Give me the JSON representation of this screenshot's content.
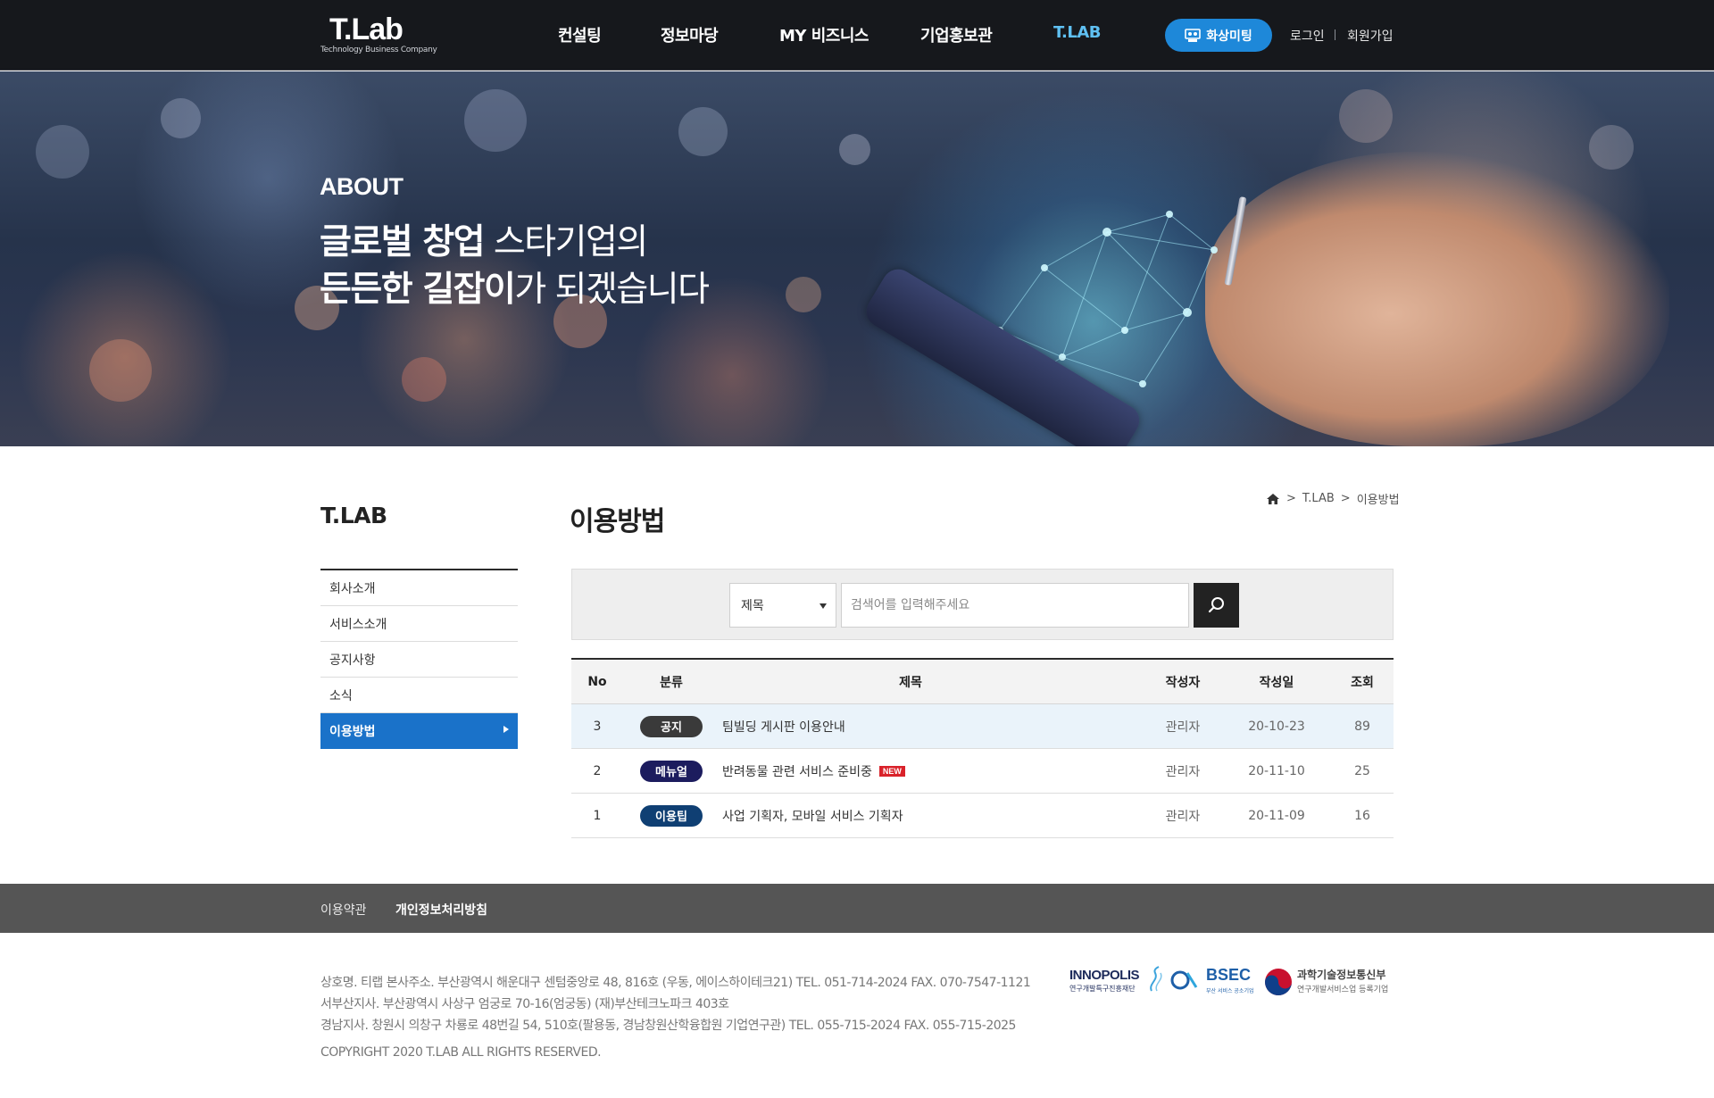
{
  "header": {
    "logo_main": "T.Lab",
    "logo_sub": "Technology Business Company",
    "nav": [
      "컨설팅",
      "정보마당",
      "MY 비즈니스",
      "기업홍보관",
      "T.LAB"
    ],
    "meeting_button": "화상미팅",
    "login": "로그인",
    "signup": "회원가입",
    "accent_color": "#5fc0f2"
  },
  "hero": {
    "label": "ABOUT",
    "line1_bold": "글로벌 창업",
    "line1_rest": " 스타기업의",
    "line2_bold1": "든든한 길잡이",
    "line2_rest": "가 되겠습니다"
  },
  "sidebar": {
    "title": "T.LAB",
    "items": [
      {
        "label": "회사소개"
      },
      {
        "label": "서비스소개"
      },
      {
        "label": "공지사항"
      },
      {
        "label": "소식"
      },
      {
        "label": "이용방법"
      }
    ],
    "active_color": "#1a72c9"
  },
  "main": {
    "title": "이용방법",
    "breadcrumb": [
      "T.LAB",
      "이용방법"
    ],
    "breadcrumb_sep": ">",
    "search": {
      "select_value": "제목",
      "placeholder": "검색어를 입력해주세요"
    },
    "table": {
      "headers": [
        "No",
        "분류",
        "제목",
        "작성자",
        "작성일",
        "조회"
      ],
      "rows": [
        {
          "no": "3",
          "category": "공지",
          "cat_color": "#3a3a3a",
          "title": "팀빌딩 게시판 이용안내",
          "new": "",
          "author": "관리자",
          "date": "20-10-23",
          "views": "89"
        },
        {
          "no": "2",
          "category": "메뉴얼",
          "cat_color": "#1c1c5e",
          "title": "반려동물 관련 서비스 준비중",
          "new": "NEW",
          "author": "관리자",
          "date": "20-11-10",
          "views": "25"
        },
        {
          "no": "1",
          "category": "이용팁",
          "cat_color": "#0f3f73",
          "title": "사업 기획자, 모바일 서비스 기획자",
          "new": "",
          "author": "관리자",
          "date": "20-11-09",
          "views": "16"
        }
      ]
    }
  },
  "footer": {
    "links": [
      "이용약관",
      "개인정보처리방침"
    ],
    "info_line1": "상호명. 티랩   본사주소. 부산광역시 해운대구 센텀중앙로 48, 816호 (우동, 에이스하이테크21)   TEL. 051-714-2024   FAX. 070-7547-1121",
    "info_line2": "서부산지사. 부산광역시 사상구 엄궁로 70-16(엄궁동) (재)부산테크노파크 403호",
    "info_line3": "경남지사. 창원시 의창구 차룡로 48번길 54, 510호(팔용동, 경남창원산학융합원 기업연구관)   TEL. 055-715-2024   FAX. 055-715-2025",
    "copyright": "COPYRIGHT 2020 T.LAB ALL RIGHTS RESERVED.",
    "partners": {
      "innopolis": "INNOPOLIS",
      "innopolis_sub": "연구개발특구진흥재단",
      "bsec": "BSEC",
      "bsec_sub": "부산 서비스 공소기업",
      "msit": "과학기술정보통신부",
      "msit_sub": "연구개발서비스업 등록기업"
    }
  }
}
